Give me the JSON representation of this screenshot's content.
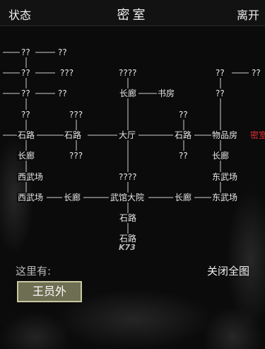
{
  "header": {
    "left": "状态",
    "title": "密室",
    "right": "离开"
  },
  "map": {
    "nodes": [
      {
        "id": "n1",
        "label": "??"
      },
      {
        "id": "n2",
        "label": "??"
      },
      {
        "id": "n3",
        "label": "??"
      },
      {
        "id": "n4",
        "label": "???"
      },
      {
        "id": "n5",
        "label": "????"
      },
      {
        "id": "n6",
        "label": "??"
      },
      {
        "id": "n7",
        "label": "??"
      },
      {
        "id": "n8",
        "label": "??"
      },
      {
        "id": "n9",
        "label": "??"
      },
      {
        "id": "n10",
        "label": "长廊"
      },
      {
        "id": "n11",
        "label": "书房"
      },
      {
        "id": "n12",
        "label": "??"
      },
      {
        "id": "n13",
        "label": "??"
      },
      {
        "id": "n14",
        "label": "???"
      },
      {
        "id": "n15",
        "label": "??"
      },
      {
        "id": "n16",
        "label": "石路"
      },
      {
        "id": "n17",
        "label": "石路"
      },
      {
        "id": "n18",
        "label": "大厅"
      },
      {
        "id": "n19",
        "label": "石路"
      },
      {
        "id": "n20",
        "label": "物品房"
      },
      {
        "id": "n21",
        "label": "密室"
      },
      {
        "id": "n22",
        "label": "长廊"
      },
      {
        "id": "n23",
        "label": "???"
      },
      {
        "id": "n24",
        "label": "??"
      },
      {
        "id": "n25",
        "label": "长廊"
      },
      {
        "id": "n26",
        "label": "西武场"
      },
      {
        "id": "n27",
        "label": "????"
      },
      {
        "id": "n28",
        "label": "东武场"
      },
      {
        "id": "n29",
        "label": "西武场"
      },
      {
        "id": "n30",
        "label": "长廊"
      },
      {
        "id": "n31",
        "label": "武馆大院"
      },
      {
        "id": "n32",
        "label": "长廊"
      },
      {
        "id": "n33",
        "label": "东武场"
      },
      {
        "id": "n34",
        "label": "石路"
      },
      {
        "id": "n35",
        "label": "石路"
      }
    ]
  },
  "footer": {
    "here_label": "这里有:",
    "close_map": "关闭全图",
    "npc_button": "王员外",
    "logo_text": "K73"
  },
  "colors": {
    "current_room": "#e03030",
    "npc_button_bg": "#6e6e52"
  }
}
